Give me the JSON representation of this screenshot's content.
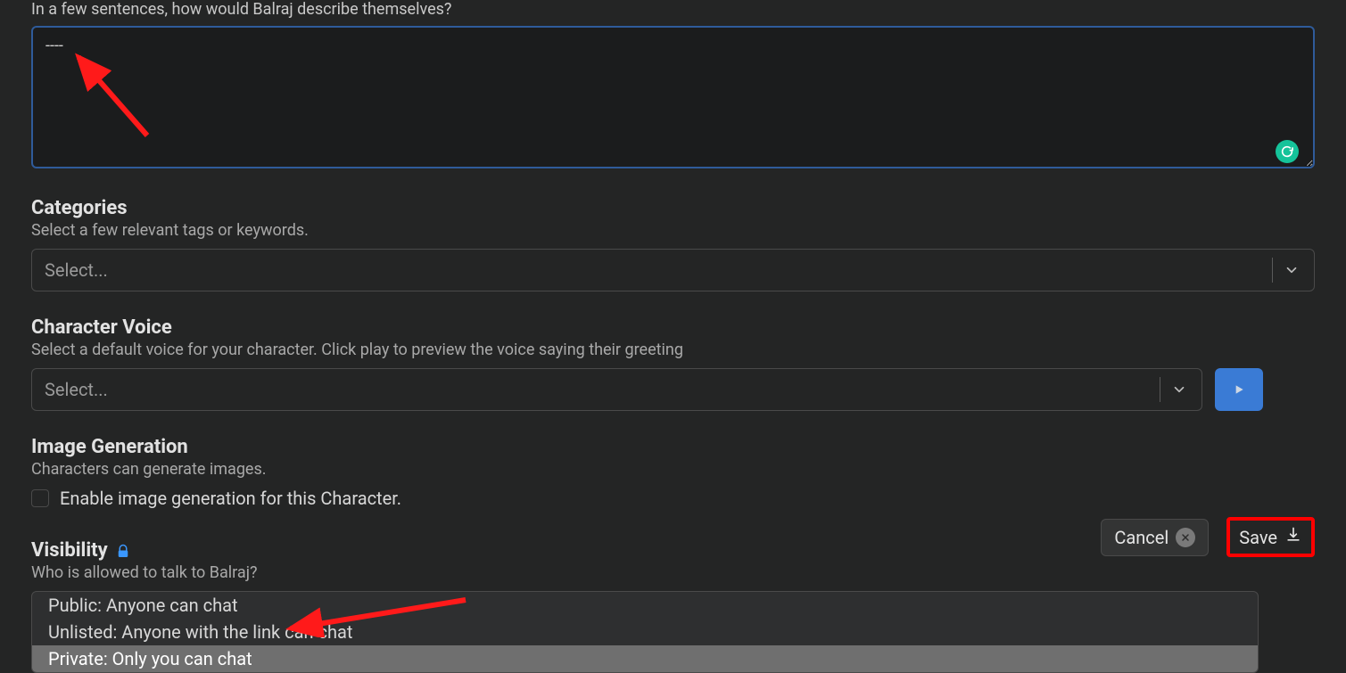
{
  "description": {
    "label": "In a few sentences, how would Balraj describe themselves?",
    "value": "----"
  },
  "categories": {
    "heading": "Categories",
    "sub": "Select a few relevant tags or keywords.",
    "placeholder": "Select..."
  },
  "voice": {
    "heading": "Character Voice",
    "sub": "Select a default voice for your character. Click play to preview the voice saying their greeting",
    "placeholder": "Select..."
  },
  "imagegen": {
    "heading": "Image Generation",
    "sub": "Characters can generate images.",
    "checkbox_label": "Enable image generation for this Character."
  },
  "visibility": {
    "heading": "Visibility",
    "sub": "Who is allowed to talk to Balraj?",
    "options": {
      "public": "Public: Anyone can chat",
      "unlisted": "Unlisted: Anyone with the link can chat",
      "private": "Private: Only you can chat"
    }
  },
  "actions": {
    "cancel": "Cancel",
    "save": "Save"
  },
  "colors": {
    "accent_blue": "#3a7bd5",
    "grammarly_green": "#15c39a",
    "highlight_red": "#ff0000"
  }
}
